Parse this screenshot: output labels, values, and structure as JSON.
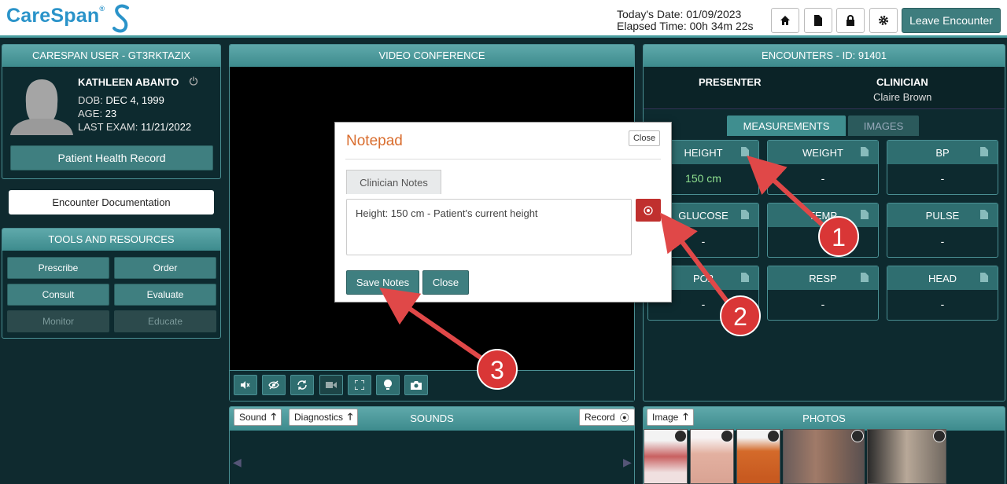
{
  "header": {
    "logo_text": "CareSpan",
    "logo_mark": "®",
    "today_label": "Today's Date: 01/09/2023",
    "elapsed_label": "Elapsed Time: 00h 34m 22s",
    "leave_label": "Leave Encounter",
    "icons": [
      "home-icon",
      "document-icon",
      "lock-icon",
      "gear-icon"
    ]
  },
  "patient": {
    "panel_title": "CARESPAN USER - GT3RKTAZIX",
    "name": "KATHLEEN ABANTO",
    "dob_label": "DOB:",
    "dob": "DEC 4, 1999",
    "age_label": "AGE:",
    "age": "23",
    "exam_label": "LAST EXAM:",
    "exam": "11/21/2022",
    "phr_button": "Patient Health Record"
  },
  "encounter_doc_button": "Encounter Documentation",
  "tools": {
    "title": "TOOLS AND RESOURCES",
    "buttons": [
      "Prescribe",
      "Order",
      "Consult",
      "Evaluate",
      "Monitor",
      "Educate"
    ]
  },
  "video": {
    "title": "VIDEO CONFERENCE"
  },
  "encounters": {
    "title": "ENCOUNTERS - ID: 91401",
    "presenter_label": "PRESENTER",
    "clinician_label": "CLINICIAN",
    "clinician_name": "Claire Brown",
    "tabs": [
      "MEASUREMENTS",
      "IMAGES"
    ],
    "measurements": [
      {
        "label": "HEIGHT",
        "value": "150 cm"
      },
      {
        "label": "WEIGHT",
        "value": "-"
      },
      {
        "label": "BP",
        "value": "-"
      },
      {
        "label": "GLUCOSE",
        "value": "-"
      },
      {
        "label": "TEMP",
        "value": "-"
      },
      {
        "label": "PULSE",
        "value": "-"
      },
      {
        "label": "PO2",
        "value": "-"
      },
      {
        "label": "RESP",
        "value": "-"
      },
      {
        "label": "HEAD",
        "value": "-"
      }
    ]
  },
  "sounds": {
    "title": "SOUNDS",
    "sound_btn": "Sound",
    "diag_btn": "Diagnostics",
    "record_btn": "Record"
  },
  "photos": {
    "title": "PHOTOS",
    "image_btn": "Image"
  },
  "notepad": {
    "title": "Notepad",
    "close_top": "Close",
    "tab": "Clinician Notes",
    "text": "Height: 150 cm - Patient's current height",
    "save": "Save Notes",
    "close": "Close"
  },
  "callouts": [
    "1",
    "2",
    "3"
  ],
  "colors": {
    "teal": "#3f7f80",
    "header_teal": "#4a9ea0",
    "accent_orange": "#d96d2e",
    "record_red": "#c0302e",
    "callout_red": "#d93636",
    "value_green": "#8fe08f"
  }
}
